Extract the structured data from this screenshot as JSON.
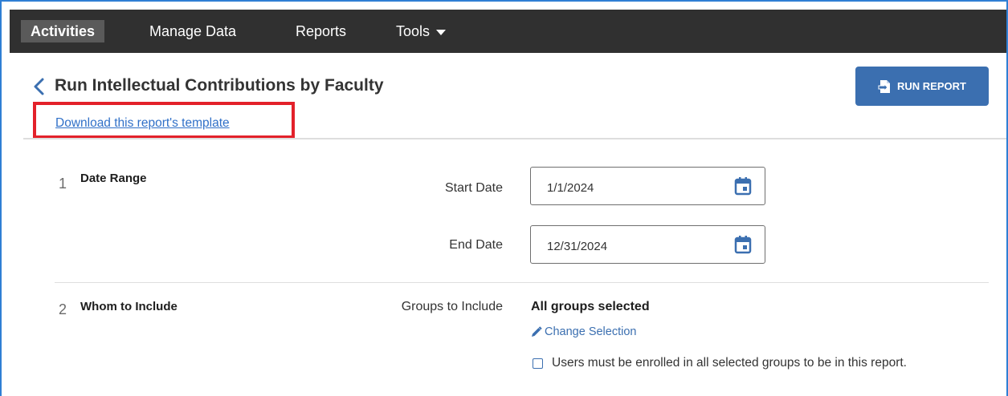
{
  "nav": {
    "items": [
      {
        "label": "Activities",
        "active": true
      },
      {
        "label": "Manage Data"
      },
      {
        "label": "Reports"
      },
      {
        "label": "Tools"
      }
    ]
  },
  "header": {
    "back_icon": "chevron-left-icon",
    "title": "Run Intellectual Contributions by Faculty",
    "run_button_label": "RUN REPORT",
    "run_button_icon": "run-report-icon",
    "download_link": "Download this report's template"
  },
  "sections": [
    {
      "number": "1",
      "title": "Date Range",
      "fields": [
        {
          "label": "Start Date",
          "value": "1/1/2024",
          "icon": "calendar-icon"
        },
        {
          "label": "End Date",
          "value": "12/31/2024",
          "icon": "calendar-icon"
        }
      ]
    },
    {
      "number": "2",
      "title": "Whom to Include",
      "groups_label": "Groups to Include",
      "groups_value": "All groups selected",
      "change_link": "Change Selection",
      "change_icon": "pencil-icon",
      "checkbox_label": "Users must be enrolled in all selected groups to be in this report.",
      "checkbox_checked": false
    }
  ],
  "colors": {
    "nav_bg": "#303030",
    "nav_active": "#5a5a5a",
    "primary": "#3b6fb0",
    "link": "#3070c8",
    "highlight": "#e3212a"
  }
}
